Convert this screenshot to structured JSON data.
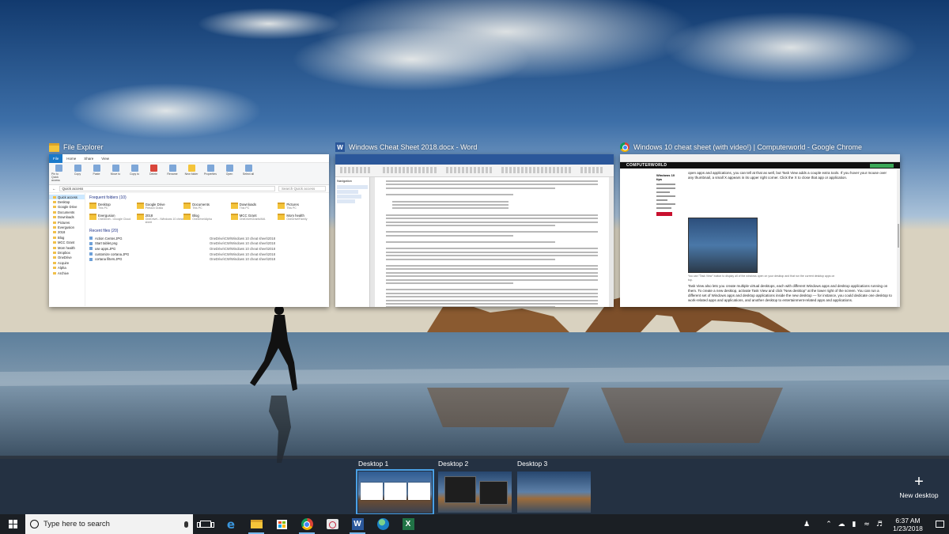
{
  "task_view": {
    "windows": [
      {
        "title": "File Explorer",
        "app_icon": "file-explorer-icon",
        "ribbon_tabs": [
          "File",
          "Home",
          "Share",
          "View"
        ],
        "ribbon_buttons": [
          "Pin to Quick access",
          "Copy",
          "Paste",
          "Move to",
          "Copy to",
          "Delete",
          "Rename",
          "New folder",
          "Properties",
          "Open",
          "Select all"
        ],
        "ribbon_groups": [
          "Clipboard",
          "Organize",
          "New",
          "Open",
          "Select"
        ],
        "address": "Quick access",
        "search_placeholder": "Search Quick access",
        "nav": [
          "Quick access",
          "Desktop",
          "Google Drive",
          "Documents",
          "Downloads",
          "Pictures",
          "Evergusion",
          "2018",
          "Blog",
          "MCC Grant",
          "Mom health",
          "Dropbox",
          "OneDrive",
          "Acquire",
          "Alpha",
          "Archive"
        ],
        "frequent_header": "Frequent folders (10)",
        "frequent": [
          {
            "name": "Desktop",
            "sub": "This PC"
          },
          {
            "name": "Google Drive",
            "sub": "Preston Gralla"
          },
          {
            "name": "Documents",
            "sub": "This PC"
          },
          {
            "name": "Downloads",
            "sub": "This PC"
          },
          {
            "name": "Pictures",
            "sub": "This PC"
          },
          {
            "name": "Evergusion",
            "sub": "OneDrive\\...\\Google Cloud"
          },
          {
            "name": "2018",
            "sub": "OneDrive\\...\\Windows 10 cheat sheet"
          },
          {
            "name": "Blog",
            "sub": "OneDrive\\Alpha"
          },
          {
            "name": "MCC Grant",
            "sub": "OneDrive\\Grants\\MA"
          },
          {
            "name": "Mom health",
            "sub": "OneDrive\\Family"
          }
        ],
        "recent_header": "Recent files (20)",
        "recent": [
          {
            "name": "Action Center.JPG",
            "path": "OneDrive\\CW\\Windows 10 cheat sheet\\2018"
          },
          {
            "name": "Start tablet.png",
            "path": "OneDrive\\CW\\Windows 10 cheat sheet\\2018"
          },
          {
            "name": "use apps.JPG",
            "path": "OneDrive\\CW\\Windows 10 cheat sheet\\2018"
          },
          {
            "name": "customize cortana.JPG",
            "path": "OneDrive\\CW\\Windows 10 cheat sheet\\2018"
          },
          {
            "name": "cortana filters.JPG",
            "path": "OneDrive\\CW\\Windows 10 cheat sheet\\2018"
          }
        ]
      },
      {
        "title": "Windows Cheat Sheet 2018.docx - Word",
        "app_icon": "word-icon",
        "nav_header": "Navigation"
      },
      {
        "title": "Windows 10 cheat sheet (with video!) | Computerworld - Google Chrome",
        "app_icon": "chrome-icon",
        "site_logo": "COMPUTERWORLD",
        "sidebar_title": "Windows 10 tips",
        "paragraph_1": "open apps and applications, you can tell at that as well, but Task View adds a couple extra tools. If you hover your mouse over any thumbnail, a small X appears in its upper right corner. Click the X to close that app or application.",
        "caption": "You can \"Task View\" button to display all of the windows open on your desktop and that run the current desktop apps on top.",
        "paragraph_2": "Task View also lets you create multiple virtual desktops, each with different Windows apps and desktop applications running on them. To create a new desktop, activate Task View and click \"New desktop\" at the lower right of the screen. You can run a different set of Windows apps and desktop applications inside the new desktop — for instance, you could dedicate one desktop to work-related apps and applications, and another desktop to entertainment-related apps and applications."
      }
    ]
  },
  "desktops": {
    "items": [
      {
        "label": "Desktop 1",
        "active": true
      },
      {
        "label": "Desktop 2",
        "active": false
      },
      {
        "label": "Desktop 3",
        "active": false
      }
    ],
    "new_desktop_label": "New desktop"
  },
  "taskbar": {
    "search_placeholder": "Type here to search",
    "pinned": [
      "task-view",
      "edge",
      "file-explorer",
      "store",
      "chrome",
      "snipping-tool",
      "word",
      "globe",
      "excel"
    ],
    "clock_time": "6:37 AM",
    "clock_date": "1/23/2018"
  },
  "colors": {
    "accent": "#4aa0e6",
    "word": "#2b579a",
    "excel": "#217346",
    "taskbar": "#1b1f24"
  }
}
